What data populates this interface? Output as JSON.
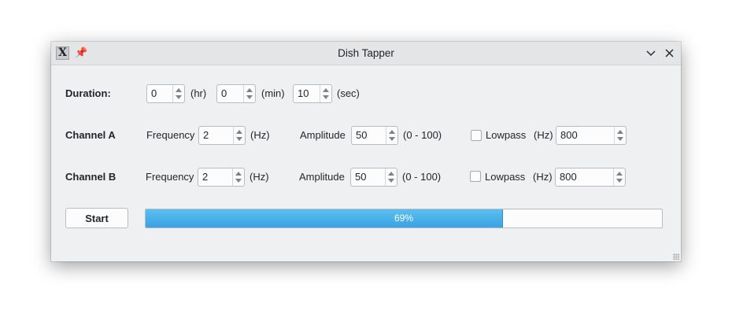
{
  "window": {
    "title": "Dish Tapper"
  },
  "icons": {
    "app": "app-icon",
    "pin": "pin-icon",
    "minimize": "chevron-down-icon",
    "close": "close-icon"
  },
  "duration": {
    "label": "Duration:",
    "hours": "0",
    "hours_unit": "(hr)",
    "minutes": "0",
    "minutes_unit": "(min)",
    "seconds": "10",
    "seconds_unit": "(sec)"
  },
  "channel_a": {
    "label": "Channel A",
    "frequency_label": "Frequency",
    "frequency": "2",
    "frequency_unit": "(Hz)",
    "amplitude_label": "Amplitude",
    "amplitude": "50",
    "amplitude_range": "(0 - 100)",
    "lowpass_label": "Lowpass",
    "lowpass_checked": false,
    "lowpass_unit": "(Hz)",
    "lowpass_value": "800"
  },
  "channel_b": {
    "label": "Channel B",
    "frequency_label": "Frequency",
    "frequency": "2",
    "frequency_unit": "(Hz)",
    "amplitude_label": "Amplitude",
    "amplitude": "50",
    "amplitude_range": "(0 - 100)",
    "lowpass_label": "Lowpass",
    "lowpass_checked": false,
    "lowpass_unit": "(Hz)",
    "lowpass_value": "800"
  },
  "controls": {
    "start_label": "Start",
    "progress_percent": 69,
    "progress_text": "69%"
  },
  "colors": {
    "progress_fill": "#3daee9",
    "window_bg": "#eff0f1"
  }
}
